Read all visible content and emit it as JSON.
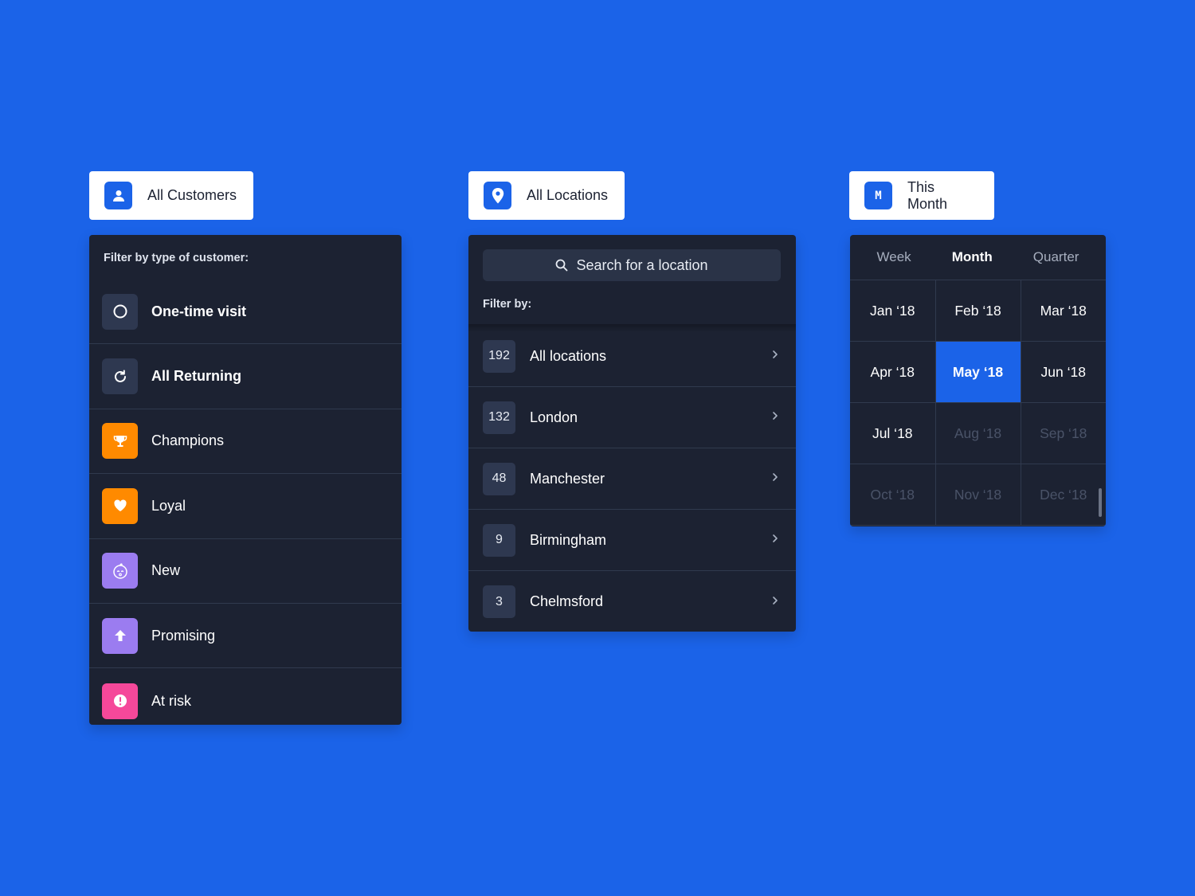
{
  "customers": {
    "pill_label": "All Customers",
    "heading": "Filter by type of customer:",
    "items": [
      {
        "label": "One-time visit",
        "icon": "circle-outline-icon",
        "bg": "#2e3850",
        "bold": true
      },
      {
        "label": "All Returning",
        "icon": "refresh-icon",
        "bg": "#2e3850",
        "bold": true
      },
      {
        "label": "Champions",
        "icon": "trophy-icon",
        "bg": "#ff8a00",
        "bold": false
      },
      {
        "label": "Loyal",
        "icon": "heart-icon",
        "bg": "#ff8a00",
        "bold": false
      },
      {
        "label": "New",
        "icon": "baby-face-icon",
        "bg": "#9b7cf0",
        "bold": false
      },
      {
        "label": "Promising",
        "icon": "arrow-up-icon",
        "bg": "#9b7cf0",
        "bold": false
      },
      {
        "label": "At risk",
        "icon": "alert-icon",
        "bg": "#f5489a",
        "bold": false
      }
    ]
  },
  "locations": {
    "pill_label": "All Locations",
    "search_placeholder": "Search for a location",
    "heading": "Filter by:",
    "items": [
      {
        "count": "192",
        "label": "All locations"
      },
      {
        "count": "132",
        "label": "London"
      },
      {
        "count": "48",
        "label": "Manchester"
      },
      {
        "count": "9",
        "label": "Birmingham"
      },
      {
        "count": "3",
        "label": "Chelmsford"
      }
    ]
  },
  "period": {
    "pill_icon_letter": "M",
    "pill_label": "This Month",
    "tabs": [
      {
        "label": "Week",
        "active": false
      },
      {
        "label": "Month",
        "active": true
      },
      {
        "label": "Quarter",
        "active": false
      }
    ],
    "months": [
      {
        "label": "Jan ‘18",
        "state": "normal"
      },
      {
        "label": "Feb ‘18",
        "state": "normal"
      },
      {
        "label": "Mar ‘18",
        "state": "normal"
      },
      {
        "label": "Apr ‘18",
        "state": "normal"
      },
      {
        "label": "May ‘18",
        "state": "selected"
      },
      {
        "label": "Jun ‘18",
        "state": "normal"
      },
      {
        "label": "Jul ‘18",
        "state": "normal"
      },
      {
        "label": "Aug ‘18",
        "state": "disabled"
      },
      {
        "label": "Sep ‘18",
        "state": "disabled"
      },
      {
        "label": "Oct ‘18",
        "state": "disabled"
      },
      {
        "label": "Nov ‘18",
        "state": "disabled"
      },
      {
        "label": "Dec ‘18",
        "state": "disabled"
      }
    ]
  },
  "colors": {
    "background": "#1b63e8",
    "panel": "#1c2232",
    "accent": "#1b63e8",
    "orange": "#ff8a00",
    "purple": "#9b7cf0",
    "pink": "#f5489a"
  }
}
